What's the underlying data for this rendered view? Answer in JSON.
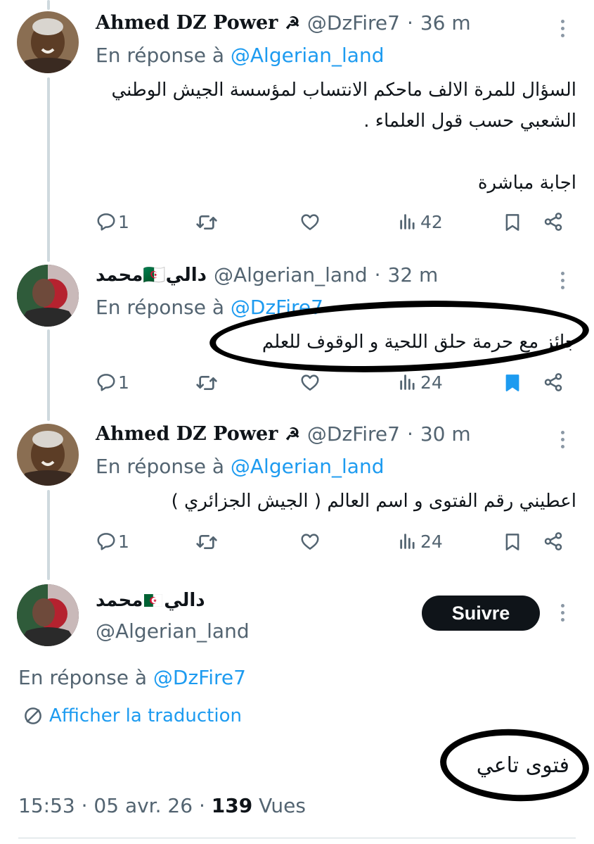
{
  "tweets": [
    {
      "name": "Ahmed DZ Power",
      "name_suffix": "☭",
      "handle": "@DzFire7",
      "sep": "·",
      "time": "36 m",
      "reply_prefix": "En réponse à",
      "reply_handle": "@Algerian_land",
      "text_lines": [
        "السؤال للمرة الالف ماحكم الانتساب لمؤسسة الجيش الوطني",
        "الشعبي حسب قول العلماء .",
        "",
        "اجابة مباشرة"
      ],
      "replies": "1",
      "views": "42",
      "bookmarked": false
    },
    {
      "name": "محمد🇩🇿دالي",
      "handle": "@Algerian_land",
      "sep": "·",
      "time": "32 m",
      "reply_prefix": "En réponse à",
      "reply_handle": "@DzFire7",
      "text_lines": [
        "جائز مع حرمة حلق اللحية و الوقوف للعلم"
      ],
      "replies": "1",
      "views": "24",
      "bookmarked": true
    },
    {
      "name": "Ahmed DZ Power",
      "name_suffix": "☭",
      "handle": "@DzFire7",
      "sep": "·",
      "time": "30 m",
      "reply_prefix": "En réponse à",
      "reply_handle": "@Algerian_land",
      "text_lines": [
        "اعطيني رقم الفتوى و اسم العالم ( الجيش الجزائري )"
      ],
      "replies": "1",
      "views": "24",
      "bookmarked": false
    }
  ],
  "main": {
    "name_part1": "محمد",
    "name_part2": "دالي",
    "handle": "@Algerian_land",
    "follow_label": "Suivre",
    "reply_prefix": "En réponse à",
    "reply_handle": "@DzFire7",
    "translate_label": "Afficher la traduction",
    "text": "فتوى تاعي",
    "time": "15:53",
    "date": "05 avr. 26",
    "views_count": "139",
    "views_label": "Vues"
  },
  "colors": {
    "link": "#1d9bf0",
    "muted": "#536471",
    "text": "#0f1419",
    "line": "#cfd9de"
  },
  "icons": [
    "reply-icon",
    "retweet-icon",
    "like-icon",
    "views-icon",
    "bookmark-icon",
    "share-icon",
    "more-icon",
    "translate-icon",
    "algeria-flag-icon"
  ]
}
